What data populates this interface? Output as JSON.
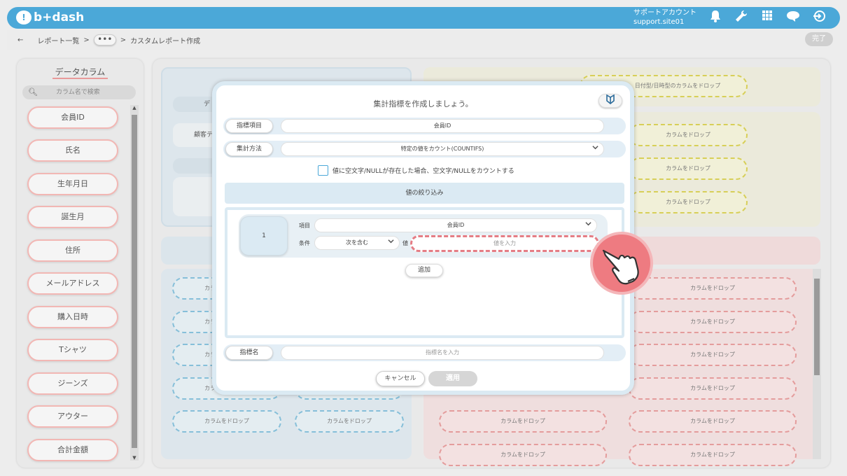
{
  "header": {
    "logo_text": "b+dash",
    "account_line1": "サポートアカウント",
    "account_line2": "support.site01"
  },
  "breadcrumb": {
    "back": "←",
    "item1": "レポート一覧",
    "sep": ">",
    "dots": "•••",
    "current": "カスタムレポート作成",
    "done": "完了"
  },
  "sidebar": {
    "title": "データカラム",
    "search_placeholder": "カラム名で検索",
    "items": [
      "会員ID",
      "氏名",
      "生年月日",
      "誕生月",
      "住所",
      "メールアドレス",
      "購入日時",
      "Tシャツ",
      "ジーンズ",
      "アウター",
      "合計金額"
    ]
  },
  "background": {
    "drop_label": "カラムをドロップ",
    "date_drop_label": "日付型/日時型のカラムをドロップ",
    "partial_left1": "デ",
    "partial_left2": "顧客テ"
  },
  "modal": {
    "title": "集計指標を作成しましょう。",
    "metric_item_label": "指標項目",
    "metric_item_value": "会員ID",
    "agg_method_label": "集計方法",
    "agg_method_value": "特定の値をカウント(COUNTIFS)",
    "checkbox_label": "値に空文字/NULLが存在した場合、空文字/NULLをカウントする",
    "filter_title": "値の絞り込み",
    "filter": {
      "number": "1",
      "item_label": "項目",
      "item_value": "会員ID",
      "cond_label": "条件",
      "cond_value": "次を含む",
      "value_label": "値",
      "value_placeholder": "値を入力"
    },
    "add_button": "追加",
    "metric_name_label": "指標名",
    "metric_name_placeholder": "指標名を入力",
    "cancel_button": "キャンセル",
    "apply_button": "適用"
  }
}
